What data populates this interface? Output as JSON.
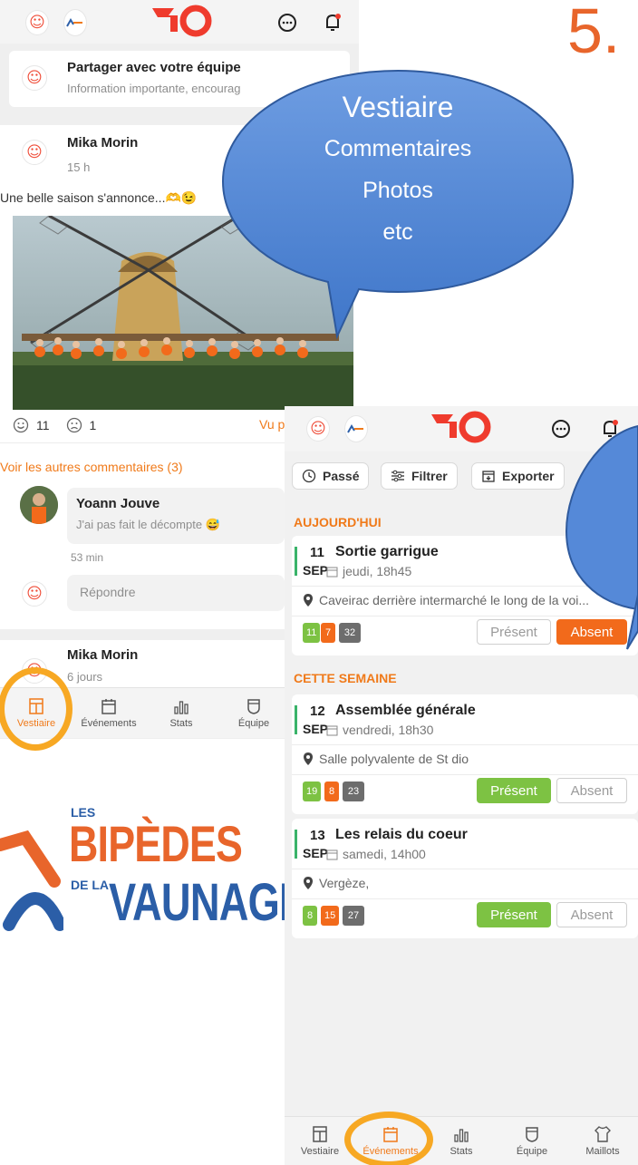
{
  "slide_number": "5.",
  "bubble": {
    "line1": "Vestiaire",
    "line2": "Commentaires",
    "line3": "Photos",
    "line4": "etc"
  },
  "left": {
    "share": {
      "title": "Partager avec votre équipe",
      "subtitle": "Information importante, encourag"
    },
    "post": {
      "author": "Mika Morin",
      "time": "15 h",
      "text": "Une belle saison s'annonce...🫶😉",
      "reactions": {
        "happy_count": "11",
        "sad_count": "1"
      },
      "seen_by": "Vu p",
      "more_comments": "Voir les autres commentaires (3)",
      "comment": {
        "author": "Yoann Jouve",
        "text": "J'ai pas fait le décompte 😅",
        "time": "53 min"
      },
      "reply_placeholder": "Répondre"
    },
    "post2": {
      "author": "Mika Morin",
      "time": "6 jours"
    },
    "nav": {
      "vestiaire": "Vestiaire",
      "evenements": "Événements",
      "stats": "Stats",
      "equipe": "Équipe"
    }
  },
  "logo": {
    "les": "LES",
    "bipedes": "BIPÈDES",
    "dela": "DE LA",
    "vaunage": "VAUNAGE"
  },
  "right": {
    "filters": {
      "passe": "Passé",
      "filtrer": "Filtrer",
      "exporter": "Exporter"
    },
    "sections": {
      "today": "AUJOURD'HUI",
      "week": "CETTE SEMAINE"
    },
    "events": [
      {
        "day": "11",
        "month": "SEP",
        "title": "Sortie garrigue",
        "when": "jeudi, 18h45",
        "place": "Caveirac derrière intermarché le long de la voi...",
        "green": "11",
        "orange": "7",
        "gray": "32",
        "present": "Présent",
        "absent": "Absent",
        "status": "absent"
      },
      {
        "day": "12",
        "month": "SEP",
        "title": "Assemblée générale",
        "when": "vendredi, 18h30",
        "place": "Salle polyvalente de St dio",
        "green": "19",
        "orange": "8",
        "gray": "23",
        "present": "Présent",
        "absent": "Absent",
        "status": "present"
      },
      {
        "day": "13",
        "month": "SEP",
        "title": "Les relais du coeur",
        "when": "samedi, 14h00",
        "place": "Vergèze,",
        "green": "8",
        "orange": "15",
        "gray": "27",
        "present": "Présent",
        "absent": "Absent",
        "status": "present"
      }
    ],
    "nav": {
      "vestiaire": "Vestiaire",
      "evenements": "Événements",
      "stats": "Stats",
      "equipe": "Équipe",
      "maillots": "Maillots"
    }
  },
  "colors": {
    "accent": "#f07a1a",
    "present": "#7dc243",
    "absent": "#f26a1b",
    "bubble": "#4f86d6",
    "highlight": "#f7a823",
    "brand_red": "#ef3b2d"
  }
}
